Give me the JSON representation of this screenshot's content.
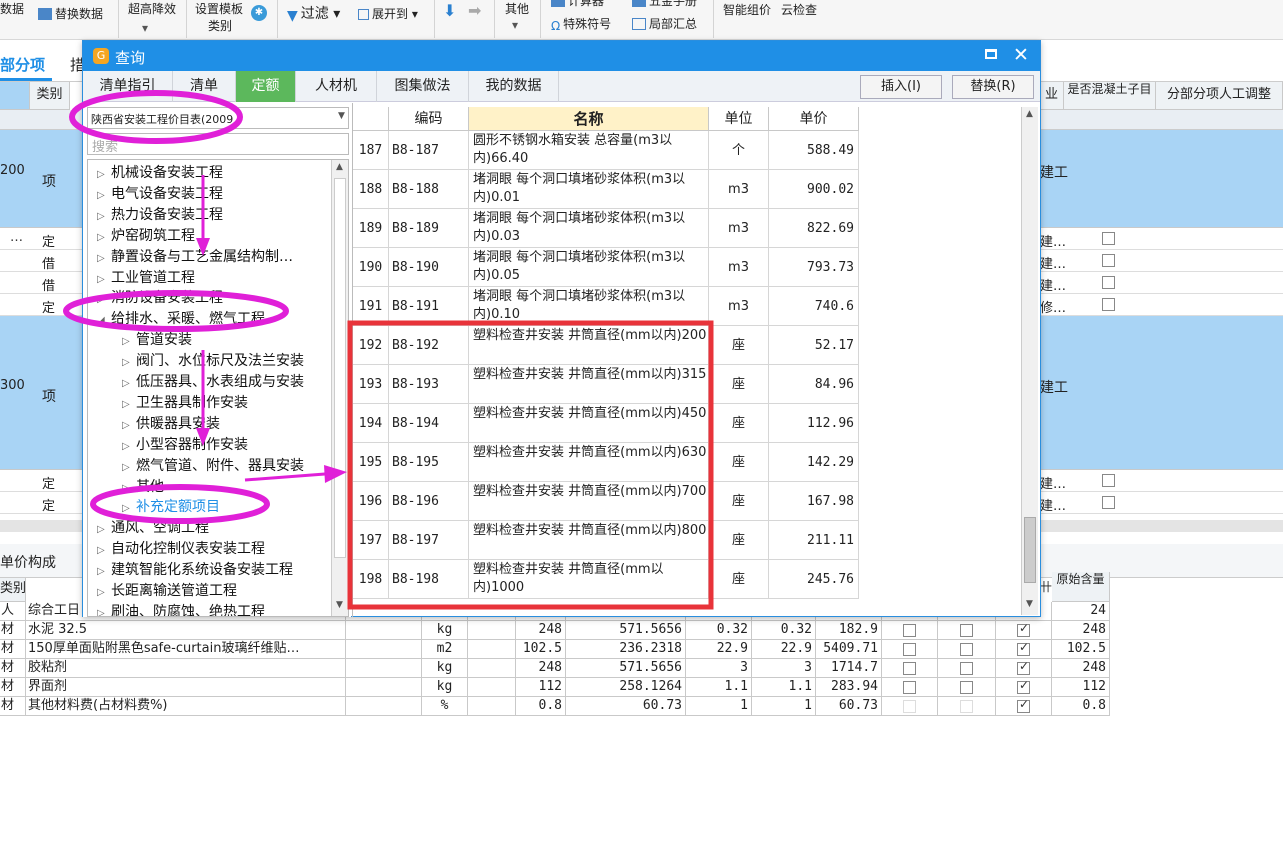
{
  "toolbar": {
    "items": [
      "数据",
      "替换数据",
      "超高降效",
      "设置模板",
      "类别",
      "过滤",
      "展开到",
      "其他",
      "计算器",
      "特殊符号",
      "五金手册",
      "局部汇总",
      "智能组价",
      "云检查"
    ]
  },
  "background": {
    "tab_left": "部分项",
    "tab_second": "措",
    "header_type": "类别",
    "header_concrete": "是否混凝土子目",
    "header_labor": "分部分项人工调整",
    "header_industry": "业",
    "rows": [
      {
        "code": "200",
        "type": "项",
        "right": "建工"
      },
      {
        "code": "…",
        "type": "定",
        "right": "建…"
      },
      {
        "code": "",
        "type": "借",
        "right": "建…"
      },
      {
        "code": "",
        "type": "借",
        "right": "建…"
      },
      {
        "code": "",
        "type": "定",
        "right": "修…"
      },
      {
        "code": "300",
        "type": "项",
        "right": "建工"
      },
      {
        "code": "",
        "type": "定",
        "right": "建…"
      },
      {
        "code": "",
        "type": "定",
        "right": "建…"
      }
    ],
    "lower_tab": "单价构成",
    "lower_header_type": "类别",
    "lower_header_orig": "原始含量",
    "lower_rows": [
      {
        "type": "人",
        "name": "综合工日",
        "unit": "",
        "a": "",
        "b": "",
        "c": "",
        "d": "",
        "e": "",
        "orig": "24"
      },
      {
        "type": "材",
        "name": "水泥 32.5",
        "unit": "kg",
        "a": "248",
        "b": "571.5656",
        "c": "0.32",
        "d": "0.32",
        "e": "182.9",
        "orig": "248"
      },
      {
        "type": "材",
        "name": "150厚单面贴附黑色safe-curtain玻璃纤维贴…",
        "unit": "m2",
        "a": "102.5",
        "b": "236.2318",
        "c": "22.9",
        "d": "22.9",
        "e": "5409.71",
        "orig": "102.5"
      },
      {
        "type": "材",
        "name": "胶粘剂",
        "unit": "kg",
        "a": "248",
        "b": "571.5656",
        "c": "3",
        "d": "3",
        "e": "1714.7",
        "orig": "248"
      },
      {
        "type": "材",
        "name": "界面剂",
        "unit": "kg",
        "a": "112",
        "b": "258.1264",
        "c": "1.1",
        "d": "1.1",
        "e": "283.94",
        "orig": "112"
      },
      {
        "type": "材",
        "name": "其他材料费(占材料费%)",
        "unit": "%",
        "a": "0.8",
        "b": "60.73",
        "c": "1",
        "d": "1",
        "e": "60.73",
        "orig": "0.8"
      }
    ]
  },
  "dialog": {
    "title": "查询",
    "tabs": [
      "清单指引",
      "清单",
      "定额",
      "人材机",
      "图集做法",
      "我的数据"
    ],
    "active_tab": "定额",
    "insert_button": "插入(I)",
    "replace_button": "替换(R)",
    "library_select": "陕西省安装工程价目表(2009",
    "search_placeholder": "搜索",
    "tree": [
      {
        "label": "机械设备安装工程",
        "level": 0
      },
      {
        "label": "电气设备安装工程",
        "level": 0
      },
      {
        "label": "热力设备安装工程",
        "level": 0
      },
      {
        "label": "炉窑砌筑工程",
        "level": 0
      },
      {
        "label": "静置设备与工艺金属结构制…",
        "level": 0
      },
      {
        "label": "工业管道工程",
        "level": 0
      },
      {
        "label": "消防设备安装工程",
        "level": 0
      },
      {
        "label": "给排水、采暖、燃气工程",
        "level": 0,
        "expanded": true
      },
      {
        "label": "管道安装",
        "level": 1
      },
      {
        "label": "阀门、水位标尺及法兰安装",
        "level": 1
      },
      {
        "label": "低压器具、水表组成与安装",
        "level": 1
      },
      {
        "label": "卫生器具制作安装",
        "level": 1
      },
      {
        "label": "供暖器具安装",
        "level": 1
      },
      {
        "label": "小型容器制作安装",
        "level": 1
      },
      {
        "label": "燃气管道、附件、器具安装",
        "level": 1
      },
      {
        "label": "其他",
        "level": 1
      },
      {
        "label": "补充定额项目",
        "level": 1,
        "selected": true
      },
      {
        "label": "通风、空调工程",
        "level": 0
      },
      {
        "label": "自动化控制仪表安装工程",
        "level": 0
      },
      {
        "label": "建筑智能化系统设备安装工程",
        "level": 0
      },
      {
        "label": "长距离输送管道工程",
        "level": 0
      },
      {
        "label": "刷油、防腐蚀、绝热工程",
        "level": 0
      }
    ],
    "grid_headers": {
      "code": "编码",
      "name": "名称",
      "unit": "单位",
      "price": "单价"
    },
    "rows": [
      {
        "no": "187",
        "code": "B8-187",
        "name": "圆形不锈钢水箱安装 总容量(m3以内)66.40",
        "unit": "个",
        "price": "588.49"
      },
      {
        "no": "188",
        "code": "B8-188",
        "name": "堵洞眼 每个洞口填堵砂浆体积(m3以内)0.01",
        "unit": "m3",
        "price": "900.02"
      },
      {
        "no": "189",
        "code": "B8-189",
        "name": "堵洞眼 每个洞口填堵砂浆体积(m3以内)0.03",
        "unit": "m3",
        "price": "822.69"
      },
      {
        "no": "190",
        "code": "B8-190",
        "name": "堵洞眼 每个洞口填堵砂浆体积(m3以内)0.05",
        "unit": "m3",
        "price": "793.73"
      },
      {
        "no": "191",
        "code": "B8-191",
        "name": "堵洞眼 每个洞口填堵砂浆体积(m3以内)0.10",
        "unit": "m3",
        "price": "740.6"
      },
      {
        "no": "192",
        "code": "B8-192",
        "name": "塑料检查井安装 井筒直径(mm以内)200",
        "unit": "座",
        "price": "52.17"
      },
      {
        "no": "193",
        "code": "B8-193",
        "name": "塑料检查井安装 井筒直径(mm以内)315",
        "unit": "座",
        "price": "84.96"
      },
      {
        "no": "194",
        "code": "B8-194",
        "name": "塑料检查井安装 井筒直径(mm以内)450",
        "unit": "座",
        "price": "112.96"
      },
      {
        "no": "195",
        "code": "B8-195",
        "name": "塑料检查井安装 井筒直径(mm以内)630",
        "unit": "座",
        "price": "142.29"
      },
      {
        "no": "196",
        "code": "B8-196",
        "name": "塑料检查井安装 井筒直径(mm以内)700",
        "unit": "座",
        "price": "167.98"
      },
      {
        "no": "197",
        "code": "B8-197",
        "name": "塑料检查井安装 井筒直径(mm以内)800",
        "unit": "座",
        "price": "211.11"
      },
      {
        "no": "198",
        "code": "B8-198",
        "name": "塑料检查井安装 井筒直径(mm以内)1000",
        "unit": "座",
        "price": "245.76"
      }
    ]
  },
  "colors": {
    "title_bar": "#1f8fe6",
    "active_tab": "#5cb85c",
    "highlight_box": "#e8333a",
    "annotation": "#e020d8",
    "selected_row": "#a9d4f5"
  }
}
